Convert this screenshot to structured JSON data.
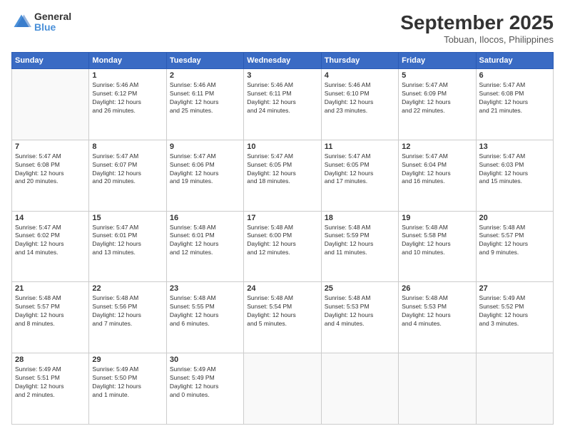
{
  "header": {
    "logo_general": "General",
    "logo_blue": "Blue",
    "month_title": "September 2025",
    "location": "Tobuan, Ilocos, Philippines"
  },
  "days_of_week": [
    "Sunday",
    "Monday",
    "Tuesday",
    "Wednesday",
    "Thursday",
    "Friday",
    "Saturday"
  ],
  "weeks": [
    [
      {
        "day": "",
        "info": ""
      },
      {
        "day": "1",
        "info": "Sunrise: 5:46 AM\nSunset: 6:12 PM\nDaylight: 12 hours\nand 26 minutes."
      },
      {
        "day": "2",
        "info": "Sunrise: 5:46 AM\nSunset: 6:11 PM\nDaylight: 12 hours\nand 25 minutes."
      },
      {
        "day": "3",
        "info": "Sunrise: 5:46 AM\nSunset: 6:11 PM\nDaylight: 12 hours\nand 24 minutes."
      },
      {
        "day": "4",
        "info": "Sunrise: 5:46 AM\nSunset: 6:10 PM\nDaylight: 12 hours\nand 23 minutes."
      },
      {
        "day": "5",
        "info": "Sunrise: 5:47 AM\nSunset: 6:09 PM\nDaylight: 12 hours\nand 22 minutes."
      },
      {
        "day": "6",
        "info": "Sunrise: 5:47 AM\nSunset: 6:08 PM\nDaylight: 12 hours\nand 21 minutes."
      }
    ],
    [
      {
        "day": "7",
        "info": "Sunrise: 5:47 AM\nSunset: 6:08 PM\nDaylight: 12 hours\nand 20 minutes."
      },
      {
        "day": "8",
        "info": "Sunrise: 5:47 AM\nSunset: 6:07 PM\nDaylight: 12 hours\nand 20 minutes."
      },
      {
        "day": "9",
        "info": "Sunrise: 5:47 AM\nSunset: 6:06 PM\nDaylight: 12 hours\nand 19 minutes."
      },
      {
        "day": "10",
        "info": "Sunrise: 5:47 AM\nSunset: 6:05 PM\nDaylight: 12 hours\nand 18 minutes."
      },
      {
        "day": "11",
        "info": "Sunrise: 5:47 AM\nSunset: 6:05 PM\nDaylight: 12 hours\nand 17 minutes."
      },
      {
        "day": "12",
        "info": "Sunrise: 5:47 AM\nSunset: 6:04 PM\nDaylight: 12 hours\nand 16 minutes."
      },
      {
        "day": "13",
        "info": "Sunrise: 5:47 AM\nSunset: 6:03 PM\nDaylight: 12 hours\nand 15 minutes."
      }
    ],
    [
      {
        "day": "14",
        "info": "Sunrise: 5:47 AM\nSunset: 6:02 PM\nDaylight: 12 hours\nand 14 minutes."
      },
      {
        "day": "15",
        "info": "Sunrise: 5:47 AM\nSunset: 6:01 PM\nDaylight: 12 hours\nand 13 minutes."
      },
      {
        "day": "16",
        "info": "Sunrise: 5:48 AM\nSunset: 6:01 PM\nDaylight: 12 hours\nand 12 minutes."
      },
      {
        "day": "17",
        "info": "Sunrise: 5:48 AM\nSunset: 6:00 PM\nDaylight: 12 hours\nand 12 minutes."
      },
      {
        "day": "18",
        "info": "Sunrise: 5:48 AM\nSunset: 5:59 PM\nDaylight: 12 hours\nand 11 minutes."
      },
      {
        "day": "19",
        "info": "Sunrise: 5:48 AM\nSunset: 5:58 PM\nDaylight: 12 hours\nand 10 minutes."
      },
      {
        "day": "20",
        "info": "Sunrise: 5:48 AM\nSunset: 5:57 PM\nDaylight: 12 hours\nand 9 minutes."
      }
    ],
    [
      {
        "day": "21",
        "info": "Sunrise: 5:48 AM\nSunset: 5:57 PM\nDaylight: 12 hours\nand 8 minutes."
      },
      {
        "day": "22",
        "info": "Sunrise: 5:48 AM\nSunset: 5:56 PM\nDaylight: 12 hours\nand 7 minutes."
      },
      {
        "day": "23",
        "info": "Sunrise: 5:48 AM\nSunset: 5:55 PM\nDaylight: 12 hours\nand 6 minutes."
      },
      {
        "day": "24",
        "info": "Sunrise: 5:48 AM\nSunset: 5:54 PM\nDaylight: 12 hours\nand 5 minutes."
      },
      {
        "day": "25",
        "info": "Sunrise: 5:48 AM\nSunset: 5:53 PM\nDaylight: 12 hours\nand 4 minutes."
      },
      {
        "day": "26",
        "info": "Sunrise: 5:48 AM\nSunset: 5:53 PM\nDaylight: 12 hours\nand 4 minutes."
      },
      {
        "day": "27",
        "info": "Sunrise: 5:49 AM\nSunset: 5:52 PM\nDaylight: 12 hours\nand 3 minutes."
      }
    ],
    [
      {
        "day": "28",
        "info": "Sunrise: 5:49 AM\nSunset: 5:51 PM\nDaylight: 12 hours\nand 2 minutes."
      },
      {
        "day": "29",
        "info": "Sunrise: 5:49 AM\nSunset: 5:50 PM\nDaylight: 12 hours\nand 1 minute."
      },
      {
        "day": "30",
        "info": "Sunrise: 5:49 AM\nSunset: 5:49 PM\nDaylight: 12 hours\nand 0 minutes."
      },
      {
        "day": "",
        "info": ""
      },
      {
        "day": "",
        "info": ""
      },
      {
        "day": "",
        "info": ""
      },
      {
        "day": "",
        "info": ""
      }
    ]
  ]
}
